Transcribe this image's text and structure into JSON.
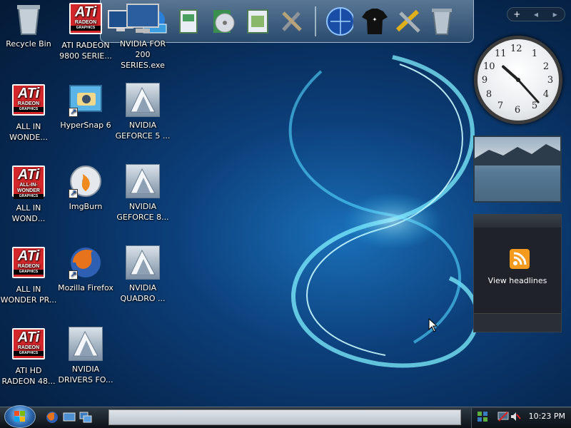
{
  "desktop": {
    "icons": [
      {
        "label": "Recycle Bin",
        "icon": "recycle-bin-icon"
      },
      {
        "label": "ATI RADEON 9800 SERIE...",
        "icon": "ati-radeon-icon"
      },
      {
        "label": "NVIDIA FOR 200 SERIES.exe",
        "icon": "nvidia-installer-icon"
      },
      {
        "label": "ALL IN WONDE...",
        "icon": "ati-radeon-icon"
      },
      {
        "label": "HyperSnap 6",
        "icon": "hypersnap-icon"
      },
      {
        "label": "NVIDIA GEFORCE 5 ...",
        "icon": "nvidia-icon"
      },
      {
        "label": "ALL IN WOND...",
        "icon": "ati-all-in-wonder-icon"
      },
      {
        "label": "ImgBurn",
        "icon": "imgburn-icon"
      },
      {
        "label": "NVIDIA GEFORCE 8...",
        "icon": "nvidia-icon"
      },
      {
        "label": "ALL IN WONDER PR...",
        "icon": "ati-radeon-icon"
      },
      {
        "label": "Mozilla Firefox",
        "icon": "firefox-icon"
      },
      {
        "label": "NVIDIA QUADRO ...",
        "icon": "nvidia-icon"
      },
      {
        "label": "ATI HD RADEON 48...",
        "icon": "ati-radeon-icon"
      },
      {
        "label": "NVIDIA DRIVERS FO...",
        "icon": "nvidia-icon"
      }
    ],
    "ati_logo": {
      "mark": "ATi",
      "brand": "RADEON",
      "sub": "GRAPHICS",
      "sub_aiw": "ALL-IN-WONDER"
    }
  },
  "dock": {
    "items": [
      "computer-icon",
      "network-icon",
      "documents-icon",
      "dvd-icon",
      "pictures-icon",
      "tools-icon",
      "internet-globe-icon",
      "tshirt-icon",
      "settings-tools-icon",
      "recycle-bin-icon"
    ]
  },
  "sidebar": {
    "add_gadget": "+",
    "prev": "◀",
    "next": "▶",
    "clock": {
      "hour": 10,
      "minute": 23,
      "numbers": [
        "12",
        "1",
        "2",
        "3",
        "4",
        "5",
        "6",
        "7",
        "8",
        "9",
        "10",
        "11"
      ]
    },
    "feed_label": "View headlines"
  },
  "taskbar": {
    "clock_time": "10:23 PM",
    "quick_launch": [
      "firefox-icon",
      "show-desktop-icon",
      "switch-windows-icon"
    ],
    "tray": [
      "network-icon",
      "monitor-icon",
      "volume-muted-icon"
    ]
  },
  "colors": {
    "ati_red": "#d3272b",
    "desktop_blue": "#0c3f7a",
    "rss_orange": "#f39a1f"
  }
}
